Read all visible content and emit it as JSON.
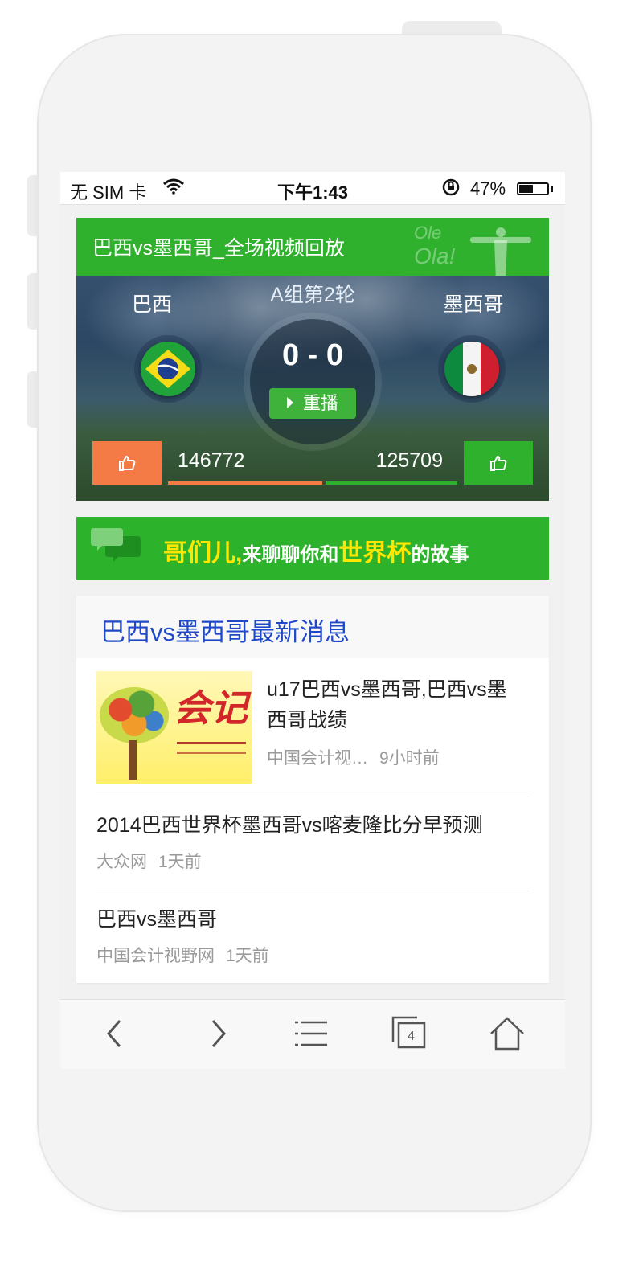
{
  "status_bar": {
    "carrier": "无 SIM 卡",
    "time": "下午1:43",
    "battery_percent": "47%",
    "battery_level": 0.47
  },
  "video": {
    "title": "巴西vs墨西哥_全场视频回放",
    "deco_ole": "Ole",
    "deco_ola": "Ola!",
    "round": "A组第2轮",
    "home_team": "巴西",
    "away_team": "墨西哥",
    "score": "0 - 0",
    "replay_label": "重播",
    "home_votes": "146772",
    "away_votes": "125709"
  },
  "banner": {
    "part1": "哥们儿,",
    "part2": "来聊聊你和",
    "part3": "世界杯",
    "part4": "的故事"
  },
  "news": {
    "title": "巴西vs墨西哥最新消息",
    "items": [
      {
        "headline": "u17巴西vs墨西哥,巴西vs墨西哥战绩",
        "source": "中国会计视…",
        "time": "9小时前"
      },
      {
        "headline": "2014巴西世界杯墨西哥vs喀麦隆比分早预测",
        "source": "大众网",
        "time": "1天前"
      },
      {
        "headline": "巴西vs墨西哥",
        "source": "中国会计视野网",
        "time": "1天前"
      }
    ]
  },
  "toolbar": {
    "tab_count": "4"
  },
  "colors": {
    "brand_green": "#2fb12e",
    "home_orange": "#f47a46",
    "news_title_blue": "#1f49c8"
  }
}
